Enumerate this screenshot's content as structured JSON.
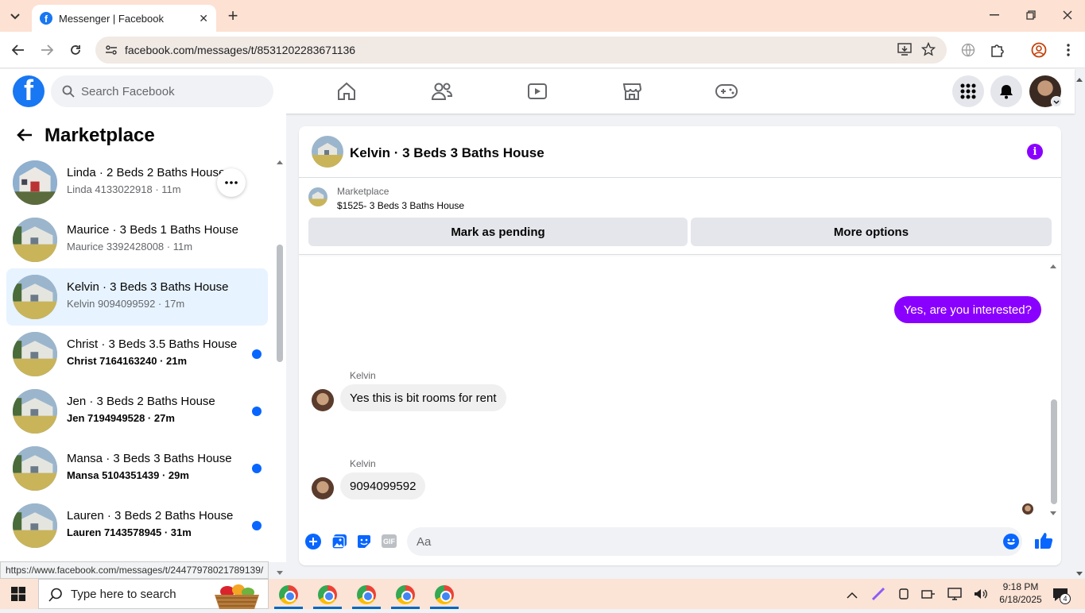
{
  "browser": {
    "tab_title": "Messenger | Facebook",
    "url": "facebook.com/messages/t/8531202283671136",
    "status_url": "https://www.facebook.com/messages/t/24477978021789139/"
  },
  "fb": {
    "search_placeholder": "Search Facebook",
    "logo_letter": "f"
  },
  "left": {
    "title": "Marketplace",
    "conversations": [
      {
        "name": "Linda · 2 Beds 2 Baths House",
        "sub": "Linda 4133022918 · 11m",
        "unread": false,
        "active": false
      },
      {
        "name": "Maurice · 3 Beds 1 Baths House",
        "sub": "Maurice 3392428008 · 11m",
        "unread": false,
        "active": false
      },
      {
        "name": "Kelvin · 3 Beds 3 Baths House",
        "sub": "Kelvin 9094099592 · 17m",
        "unread": false,
        "active": true
      },
      {
        "name": "Christ · 3 Beds 3.5 Baths House",
        "sub": "Christ 7164163240 · 21m",
        "unread": true,
        "active": false
      },
      {
        "name": "Jen · 3 Beds 2 Baths House",
        "sub": "Jen 7194949528 · 27m",
        "unread": true,
        "active": false
      },
      {
        "name": "Mansa · 3 Beds 3 Baths House",
        "sub": "Mansa 5104351439 · 29m",
        "unread": true,
        "active": false
      },
      {
        "name": "Lauren · 3 Beds 2 Baths House",
        "sub": "Lauren 7143578945 · 31m",
        "unread": true,
        "active": false
      }
    ]
  },
  "chat": {
    "title": "Kelvin · 3 Beds 3 Baths House",
    "listing_source": "Marketplace",
    "listing_title": "$1525- 3 Beds 3 Baths House",
    "mark_pending": "Mark as pending",
    "more_options": "More options",
    "messages": [
      {
        "from": "me",
        "text": "Yes, are you interested?"
      },
      {
        "from": "Kelvin",
        "sender": "Kelvin",
        "text": "Yes this is bit rooms for rent"
      },
      {
        "from": "Kelvin",
        "sender": "Kelvin",
        "text": "9094099592"
      }
    ],
    "composer_placeholder": "Aa",
    "gif_label": "GIF"
  },
  "taskbar": {
    "search_placeholder": "Type here to search",
    "time": "9:18 PM",
    "date": "6/18/2025",
    "notification_count": "4"
  },
  "colors": {
    "fb_blue": "#1877f2",
    "accent_purple": "#8a00ff",
    "unread_dot": "#0866ff"
  }
}
